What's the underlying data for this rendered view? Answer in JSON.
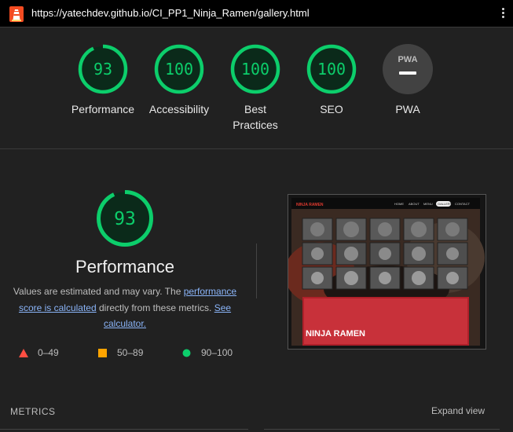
{
  "browser": {
    "url": "https://yatechdev.github.io/CI_PP1_Ninja_Ramen/gallery.html",
    "logo_icon": "lighthouse-icon",
    "menu_icon": "kebab-menu-icon"
  },
  "categories": [
    {
      "score": "93",
      "label": "Performance",
      "value": 93
    },
    {
      "score": "100",
      "label": "Accessibility",
      "value": 100
    },
    {
      "score": "100",
      "label": "Best Practices",
      "value": 100
    },
    {
      "score": "100",
      "label": "SEO",
      "value": 100
    },
    {
      "score": "PWA",
      "label": "PWA",
      "value": null
    }
  ],
  "performance": {
    "score": "93",
    "value": 93,
    "title": "Performance",
    "desc_prefix": "Values are estimated and may vary. The ",
    "link1": "performance score is calculated",
    "desc_middle": " directly from these metrics. ",
    "link2": "See calculator."
  },
  "legend": [
    {
      "range": "0–49",
      "color": "#ff4e42",
      "shape": "triangle"
    },
    {
      "range": "50–89",
      "color": "#ffa400",
      "shape": "square"
    },
    {
      "range": "90–100",
      "color": "#0cce6b",
      "shape": "circle"
    }
  ],
  "screenshot": {
    "site_logo": "NINJA RAMEN",
    "nav": [
      "HOME",
      "ABOUT",
      "MENU",
      "GALLERY",
      "CONTACT"
    ],
    "hero_text": "NINJA RAMEN"
  },
  "metrics": {
    "label": "METRICS",
    "expand": "Expand view"
  },
  "colors": {
    "pass": "#0cce6b",
    "pass_bg": "#0b2a1a",
    "link": "#8ab4f8",
    "bg": "#212121"
  }
}
